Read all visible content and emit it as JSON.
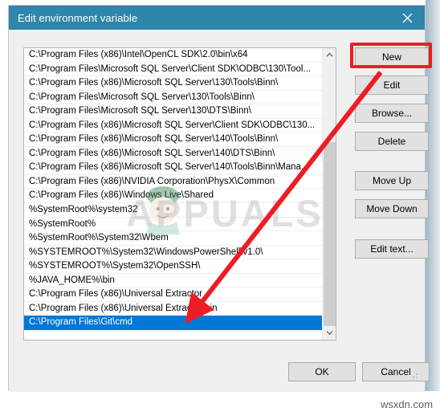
{
  "window": {
    "title": "Edit environment variable",
    "close_icon": "close-icon",
    "titlebar_color": "#2e86ab",
    "accent_selection_color": "#0078d7"
  },
  "list": {
    "scrollbar": {
      "up_arrow_icon": "chevron-up-icon",
      "down_arrow_icon": "chevron-down-icon"
    },
    "items": [
      {
        "path": "C:\\Program Files (x86)\\Intel\\OpenCL SDK\\2.0\\bin\\x64",
        "selected": false
      },
      {
        "path": "C:\\Program Files\\Microsoft SQL Server\\Client SDK\\ODBC\\130\\Tool...",
        "selected": false
      },
      {
        "path": "C:\\Program Files (x86)\\Microsoft SQL Server\\130\\Tools\\Binn\\",
        "selected": false
      },
      {
        "path": "C:\\Program Files\\Microsoft SQL Server\\130\\Tools\\Binn\\",
        "selected": false
      },
      {
        "path": "C:\\Program Files\\Microsoft SQL Server\\130\\DTS\\Binn\\",
        "selected": false
      },
      {
        "path": "C:\\Program Files (x86)\\Microsoft SQL Server\\Client SDK\\ODBC\\130...",
        "selected": false
      },
      {
        "path": "C:\\Program Files (x86)\\Microsoft SQL Server\\140\\Tools\\Binn\\",
        "selected": false
      },
      {
        "path": "C:\\Program Files (x86)\\Microsoft SQL Server\\140\\DTS\\Binn\\",
        "selected": false
      },
      {
        "path": "C:\\Program Files (x86)\\Microsoft SQL Server\\140\\Tools\\Binn\\Mana...",
        "selected": false
      },
      {
        "path": "C:\\Program Files (x86)\\NVIDIA Corporation\\PhysX\\Common",
        "selected": false
      },
      {
        "path": "C:\\Program Files (x86)\\Windows Live\\Shared",
        "selected": false
      },
      {
        "path": "%SystemRoot%\\system32",
        "selected": false
      },
      {
        "path": "%SystemRoot%",
        "selected": false
      },
      {
        "path": "%SystemRoot%\\System32\\Wbem",
        "selected": false
      },
      {
        "path": "%SYSTEMROOT%\\System32\\WindowsPowerShell\\v1.0\\",
        "selected": false
      },
      {
        "path": "%SYSTEMROOT%\\System32\\OpenSSH\\",
        "selected": false
      },
      {
        "path": "%JAVA_HOME%\\bin",
        "selected": false
      },
      {
        "path": "C:\\Program Files (x86)\\Universal Extractor",
        "selected": false
      },
      {
        "path": "C:\\Program Files (x86)\\Universal Extractor\\bin",
        "selected": false
      },
      {
        "path": "C:\\Program Files\\Git\\cmd",
        "selected": true
      }
    ]
  },
  "side_buttons": {
    "new": "New",
    "edit": "Edit",
    "browse": "Browse...",
    "delete": "Delete",
    "move_up": "Move Up",
    "move_down": "Move Down",
    "edit_text": "Edit text..."
  },
  "footer": {
    "ok": "OK",
    "cancel": "Cancel"
  },
  "annotations": {
    "highlight_target": "New",
    "highlight_color": "#ee1c24",
    "arrow_color": "#ee1c24",
    "arrow_description": "red arrow pointing from New button down to selected list entry"
  },
  "watermarks": {
    "center": "APPUALS",
    "corner": "wsxdn.com"
  }
}
